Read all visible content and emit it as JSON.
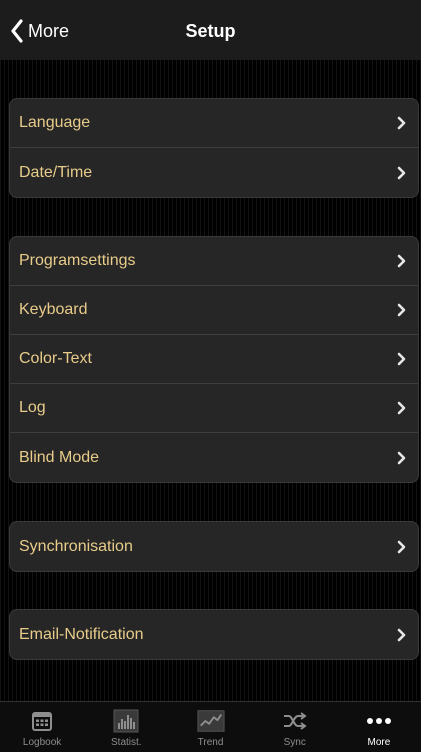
{
  "nav": {
    "back_label": "More",
    "title": "Setup"
  },
  "groups": [
    {
      "items": [
        {
          "label": "Language"
        },
        {
          "label": "Date/Time"
        }
      ]
    },
    {
      "items": [
        {
          "label": "Programsettings"
        },
        {
          "label": "Keyboard"
        },
        {
          "label": "Color-Text"
        },
        {
          "label": "Log"
        },
        {
          "label": "Blind Mode"
        }
      ]
    },
    {
      "items": [
        {
          "label": "Synchronisation"
        }
      ]
    },
    {
      "items": [
        {
          "label": "Email-Notification"
        }
      ]
    }
  ],
  "tabbar": {
    "items": [
      {
        "label": "Logbook",
        "icon": "calendar-icon"
      },
      {
        "label": "Statist.",
        "icon": "bar-chart-icon"
      },
      {
        "label": "Trend",
        "icon": "trend-icon"
      },
      {
        "label": "Sync",
        "icon": "shuffle-icon"
      },
      {
        "label": "More",
        "icon": "more-dots-icon"
      }
    ],
    "active": "More"
  },
  "colors": {
    "accent_text": "#e8cc8a",
    "background": "#000000",
    "card": "#262626"
  }
}
